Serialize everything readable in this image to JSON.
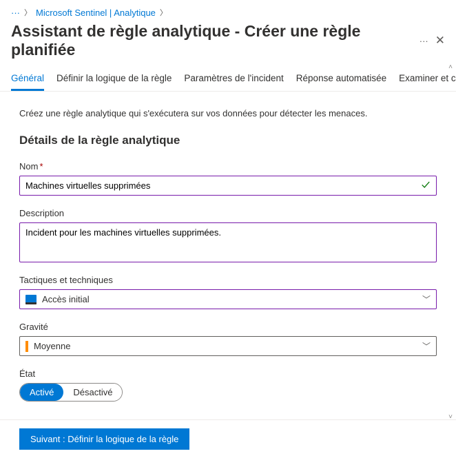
{
  "breadcrumb": {
    "dots": "···",
    "link": "Microsoft Sentinel | Analytique"
  },
  "header": {
    "title": "Assistant de règle analytique - Créer une règle planifiée",
    "more": "···",
    "close": "✕"
  },
  "tabs": [
    {
      "label": "Général"
    },
    {
      "label": "Définir la logique de la règle"
    },
    {
      "label": "Paramètres de l'incident"
    },
    {
      "label": "Réponse automatisée"
    },
    {
      "label": "Examiner et créer"
    }
  ],
  "intro": "Créez une règle analytique qui s'exécutera sur vos données pour détecter les menaces.",
  "section_title": "Détails de la règle analytique",
  "fields": {
    "name": {
      "label": "Nom",
      "value": "Machines virtuelles supprimées"
    },
    "description": {
      "label": "Description",
      "value": "Incident pour les machines virtuelles supprimées."
    },
    "tactics": {
      "label": "Tactiques et techniques",
      "value": "Accès initial"
    },
    "severity": {
      "label": "Gravité",
      "value": "Moyenne"
    },
    "status": {
      "label": "État",
      "on": "Activé",
      "off": "Désactivé"
    }
  },
  "footer": {
    "next": "Suivant : Définir la logique de la règle"
  }
}
